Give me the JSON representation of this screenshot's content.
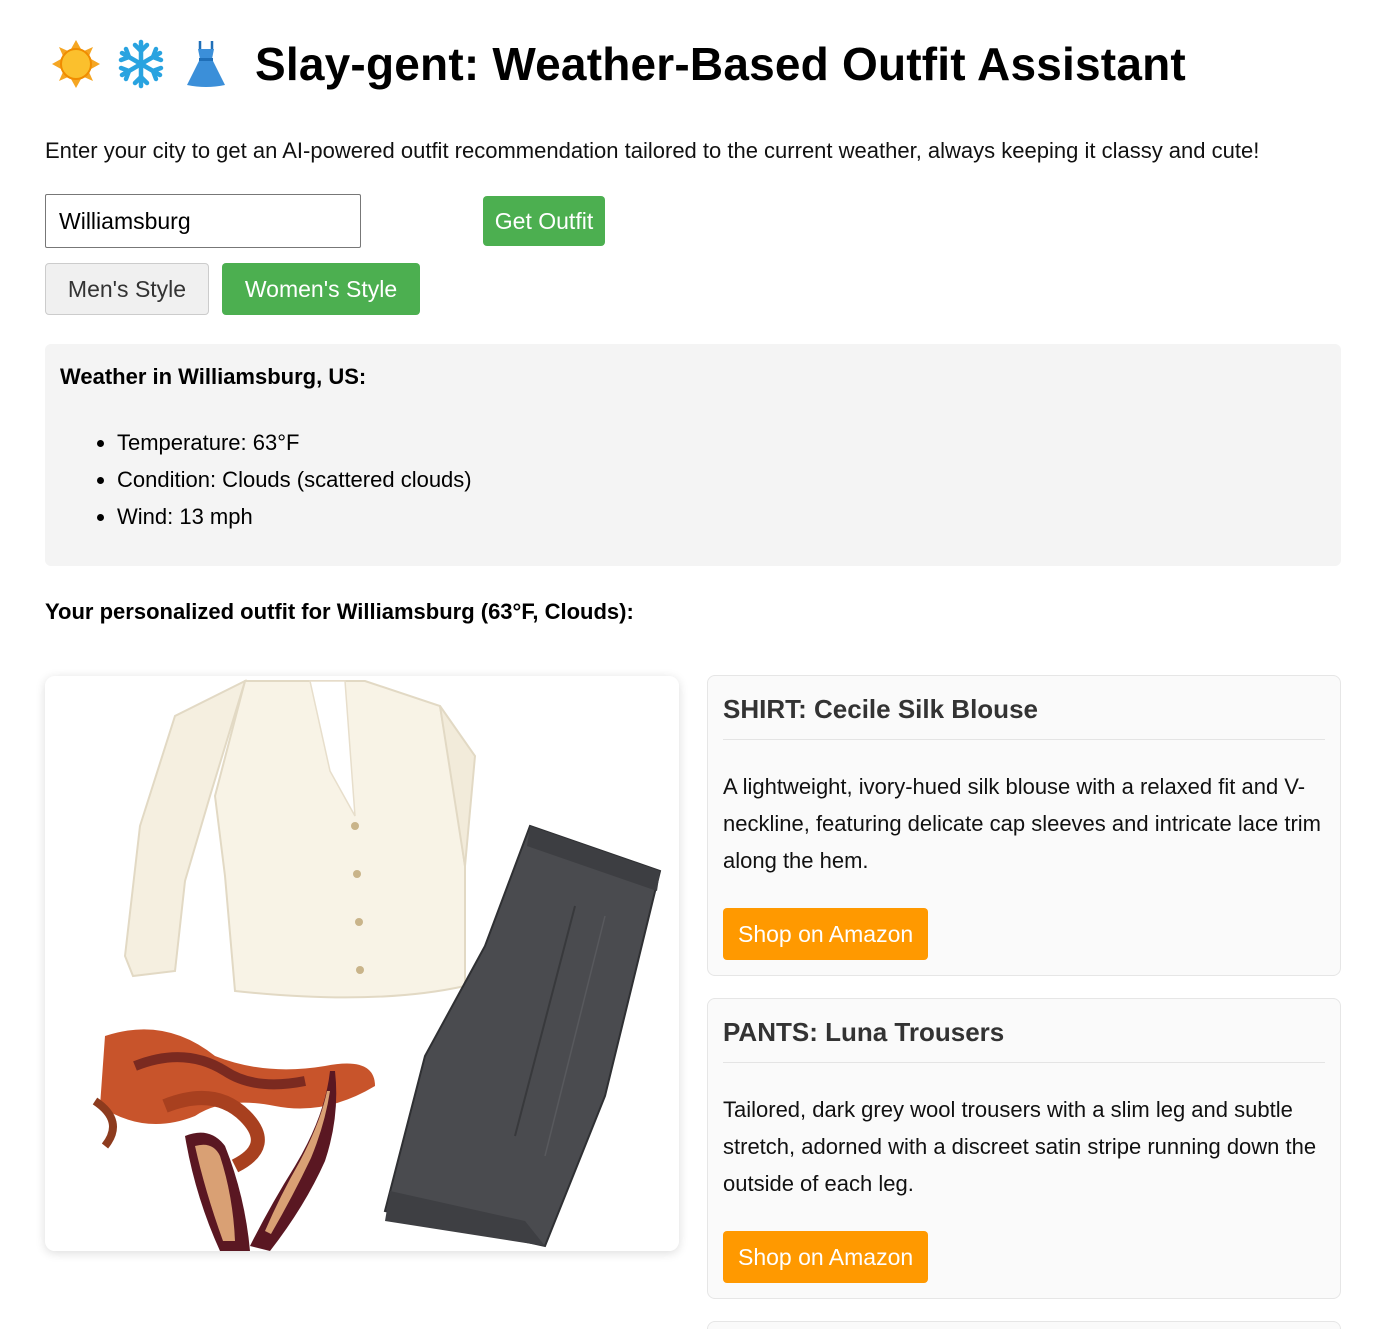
{
  "header": {
    "icons": [
      "sun-icon",
      "snowflake-icon",
      "dress-icon"
    ],
    "title": "Slay-gent: Weather-Based Outfit Assistant"
  },
  "intro_text": "Enter your city to get an AI-powered outfit recommendation tailored to the current weather, always keeping it classy and cute!",
  "search": {
    "city_value": "Williamsburg",
    "get_outfit_label": "Get Outfit"
  },
  "style_toggle": {
    "men_label": "Men's Style",
    "women_label": "Women's Style",
    "selected": "Women's Style"
  },
  "weather": {
    "heading": "Weather in Williamsburg, US:",
    "temperature": "Temperature: 63°F",
    "condition": "Condition: Clouds (scattered clouds)",
    "wind": "Wind: 13 mph"
  },
  "outfit_heading": "Your personalized outfit for Williamsburg (63°F, Clouds):",
  "items": [
    {
      "title": "SHIRT: Cecile Silk Blouse",
      "description": "A lightweight, ivory-hued silk blouse with a relaxed fit and V-neckline, featuring delicate cap sleeves and intricate lace trim along the hem.",
      "shop_label": "Shop on Amazon"
    },
    {
      "title": "PANTS: Luna Trousers",
      "description": "Tailored, dark grey wool trousers with a slim leg and subtle stretch, adorned with a discreet satin stripe running down the outside of each leg.",
      "shop_label": "Shop on Amazon"
    }
  ],
  "colors": {
    "primary_green": "#4caf50",
    "amazon_orange": "#ff9900",
    "panel_gray": "#f4f4f4"
  }
}
